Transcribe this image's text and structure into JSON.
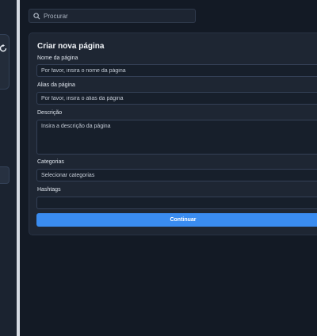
{
  "search": {
    "placeholder": "Procurar"
  },
  "form": {
    "title": "Criar nova página",
    "fields": {
      "name": {
        "label": "Nome da página",
        "placeholder": "Por favor, insira o nome da página"
      },
      "alias": {
        "label": "Alias da página",
        "placeholder": "Por favor, insira o alias da página"
      },
      "description": {
        "label": "Descrição",
        "placeholder": "Insira a descrição da página"
      },
      "categories": {
        "label": "Categorias",
        "placeholder": "Selecionar categorias"
      },
      "hashtags": {
        "label": "Hashtags",
        "placeholder": ""
      }
    },
    "submit_label": "Continuar"
  },
  "colors": {
    "accent": "#3a8cf0",
    "background": "#131a25",
    "panel": "#1e2633"
  },
  "icons": {
    "search": "search-icon",
    "sidebar_action": "refresh-icon"
  }
}
